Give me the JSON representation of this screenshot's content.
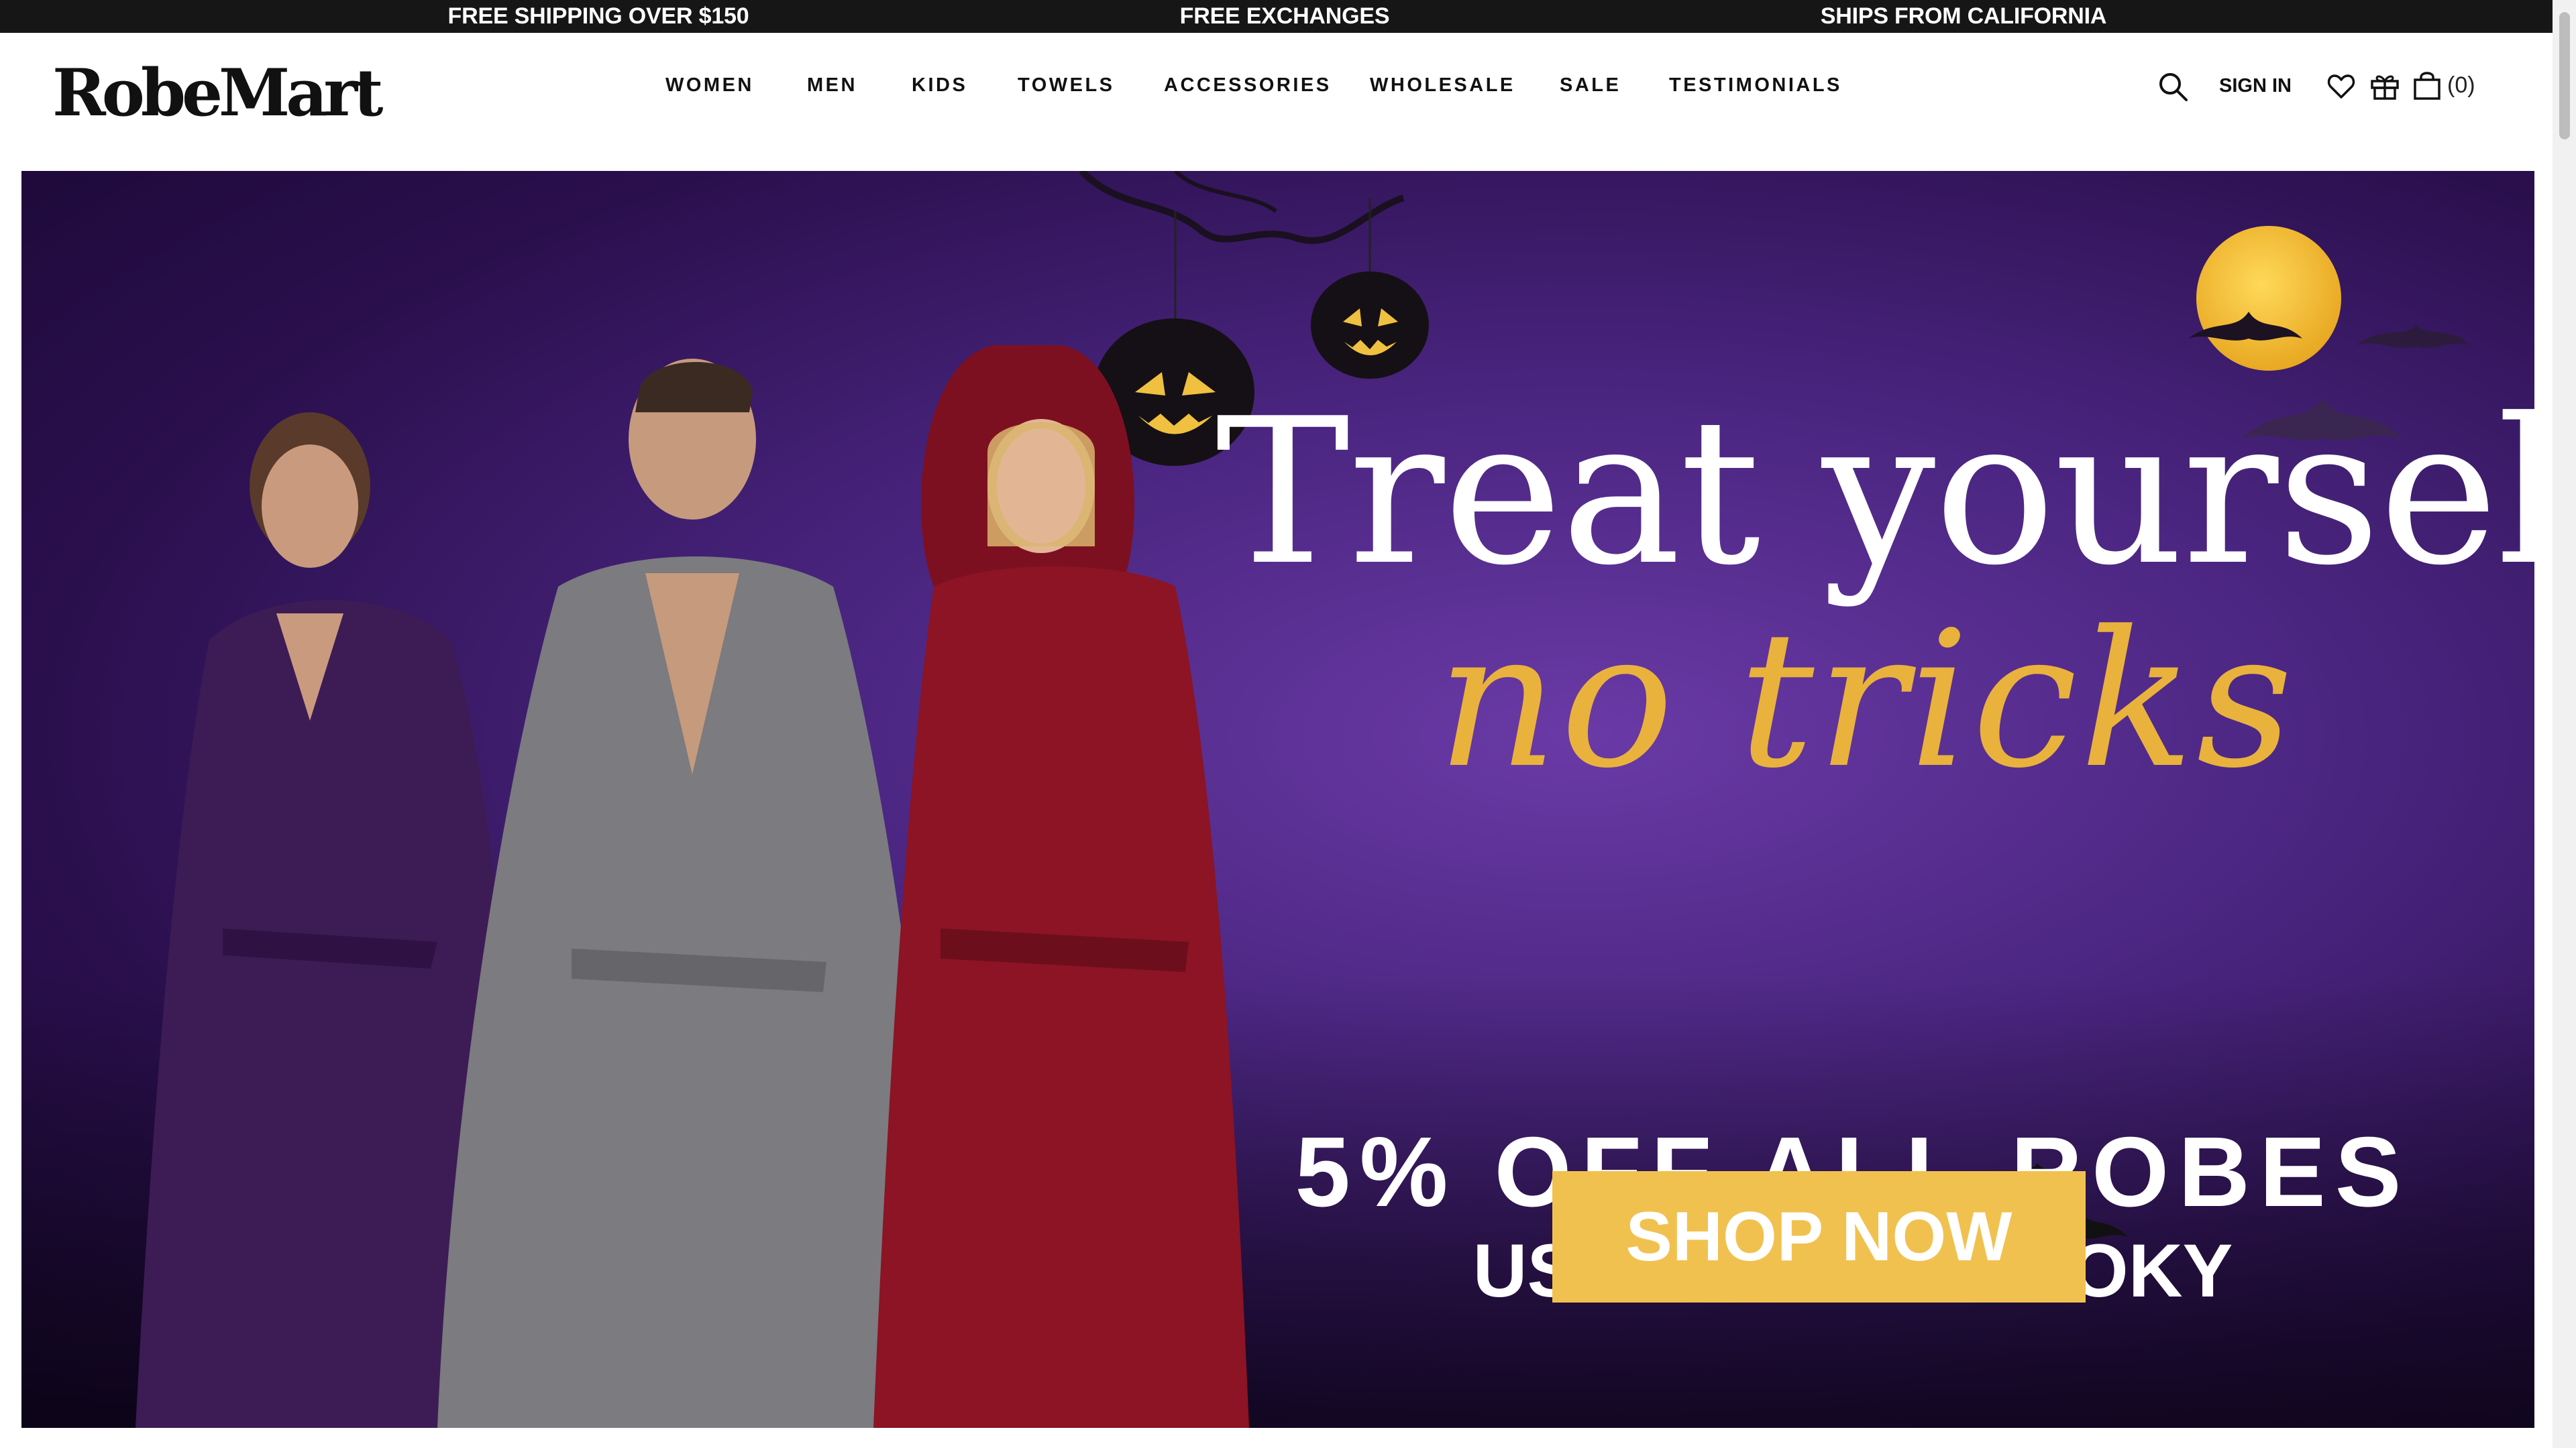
{
  "announcement": {
    "items": [
      "FREE SHIPPING OVER $150",
      "FREE EXCHANGES",
      "SHIPS FROM CALIFORNIA"
    ]
  },
  "header": {
    "logo": "RobeMart",
    "nav": [
      "WOMEN",
      "MEN",
      "KIDS",
      "TOWELS",
      "ACCESSORIES",
      "WHOLESALE",
      "SALE",
      "TESTIMONIALS"
    ],
    "sign_in": "SIGN IN",
    "cart_count": "(0)",
    "icons": [
      "search-icon",
      "heart-icon",
      "gift-icon",
      "shopping-bag-icon"
    ]
  },
  "hero": {
    "headline": "Treat yourself",
    "script": "no tricks",
    "offer": "5% OFF ALL ROBES",
    "code": "USE CODE: SPOOKY",
    "cta": "SHOP NOW"
  },
  "colors": {
    "announcement_bg": "#161616",
    "hero_purple": "#4a2580",
    "accent_gold": "#f1c14f",
    "script_gold": "#e9b23c"
  }
}
